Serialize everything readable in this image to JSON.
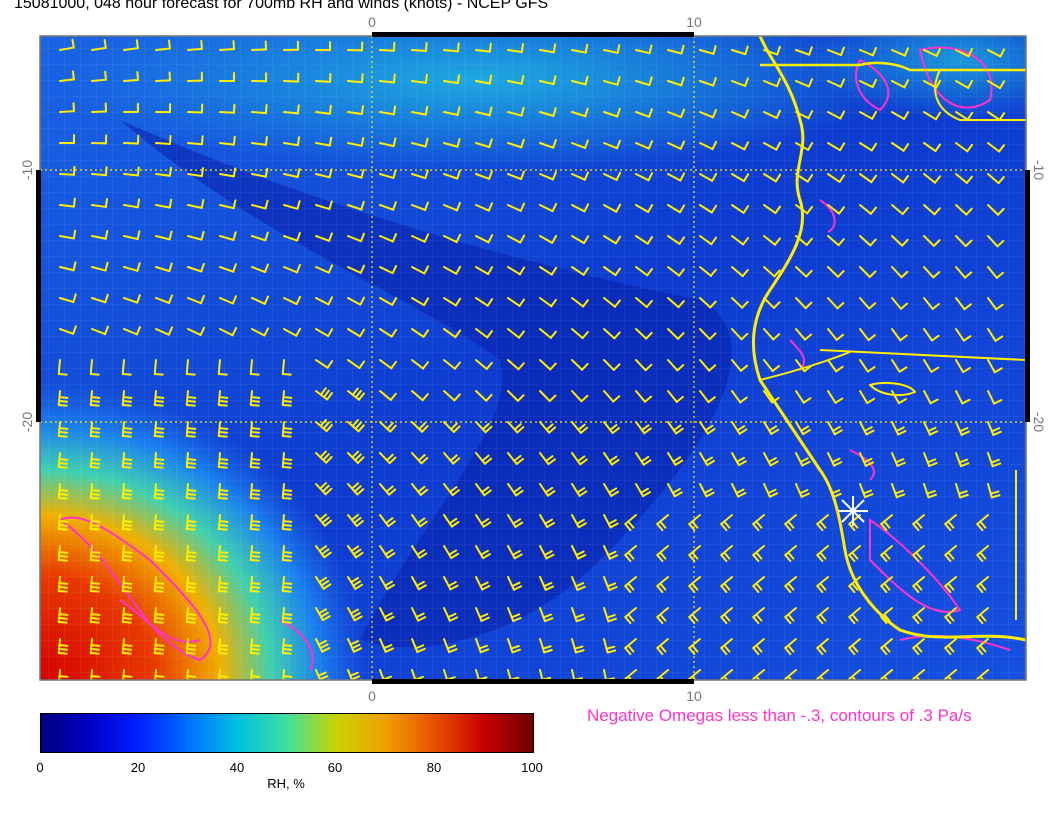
{
  "title": "15081000, 048 hour forecast for 700mb RH and winds (knots) - NCEP GFS",
  "axes": {
    "top_ticks": [
      "0",
      "10"
    ],
    "bottom_ticks": [
      "0",
      "10"
    ],
    "left_ticks": [
      "-10",
      "-20"
    ],
    "right_ticks": [
      "-10",
      "-20"
    ]
  },
  "omega_note": "Negative Omegas less than -.3, contours of .3 Pa/s",
  "colorbar": {
    "ticks": [
      "0",
      "20",
      "40",
      "60",
      "80",
      "100"
    ],
    "label": "RH, %",
    "range": [
      0,
      100
    ]
  },
  "colors": {
    "wind_barbs": "#ffee00",
    "coastline": "#ffee00",
    "omega_contours": "#ff33cc",
    "grid": "#ffee00"
  },
  "icons": {
    "station_marker": "asterisk-icon"
  }
}
